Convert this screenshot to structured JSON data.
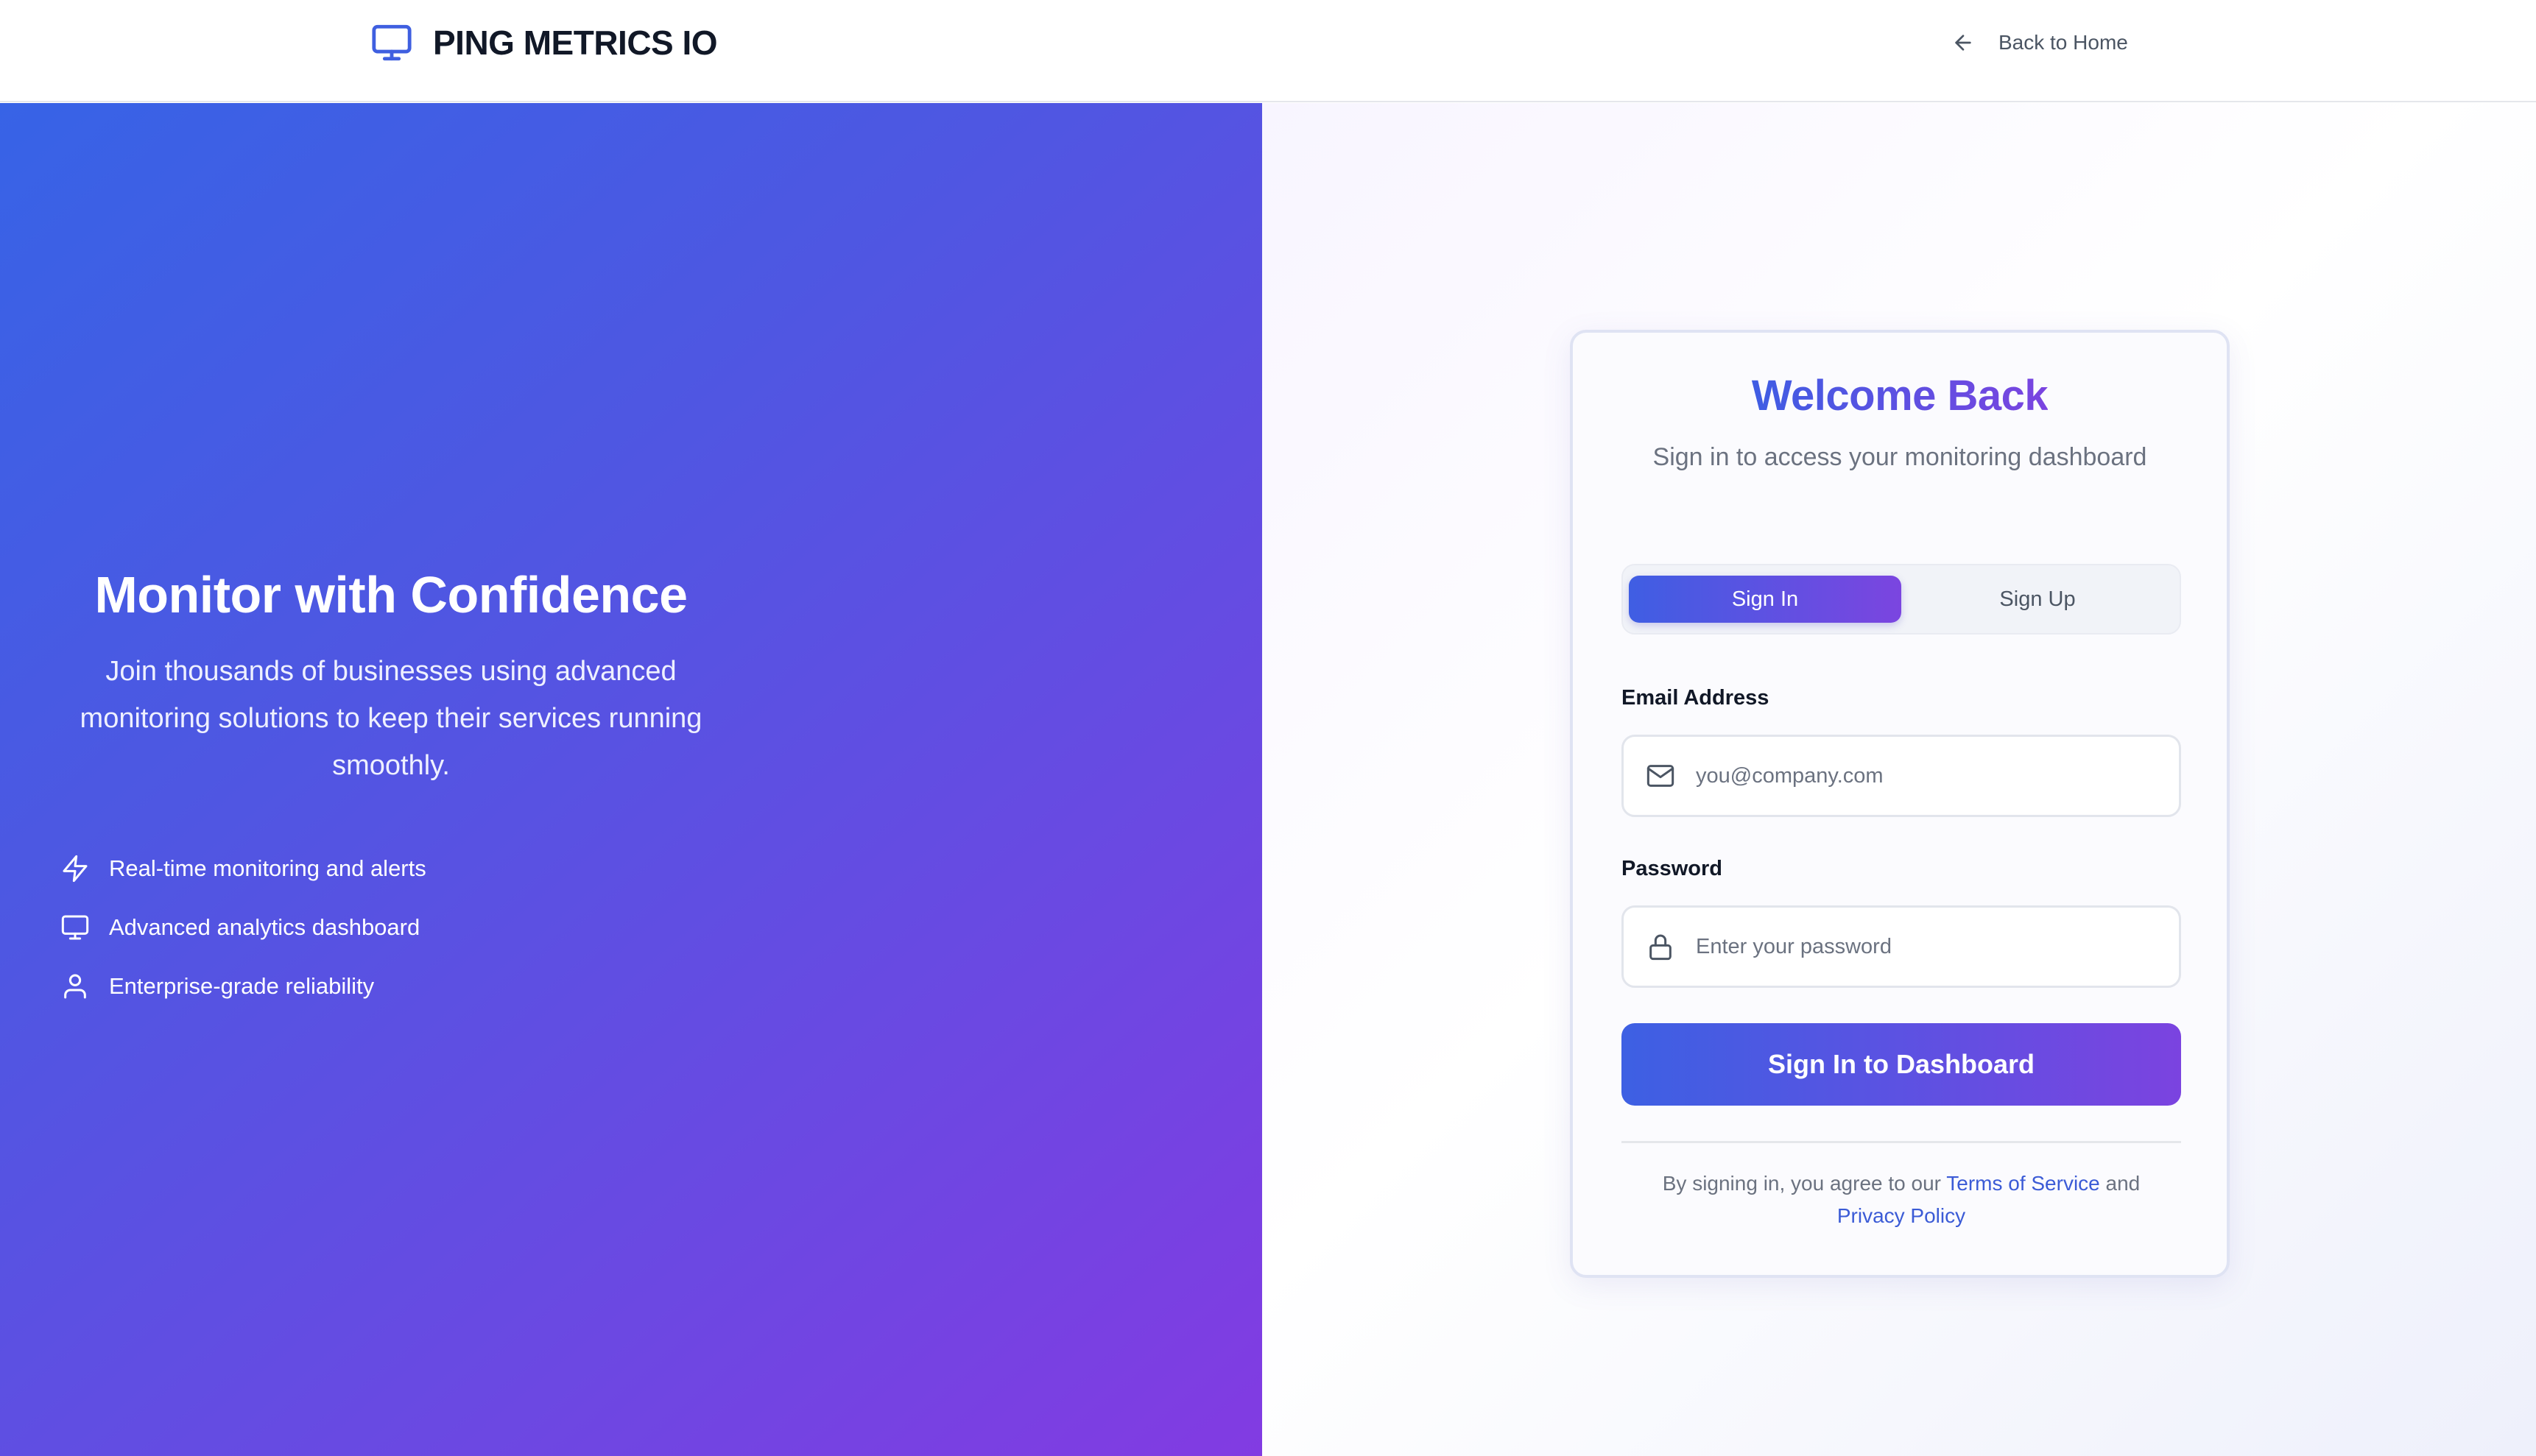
{
  "header": {
    "brand_name": "PING METRICS IO",
    "back_label": "Back to Home"
  },
  "hero": {
    "title": "Monitor with Confidence",
    "subtitle": "Join thousands of businesses using advanced monitoring solutions to keep their services running smoothly.",
    "features": [
      {
        "icon": "lightning-icon",
        "label": "Real-time monitoring and alerts"
      },
      {
        "icon": "monitor-icon",
        "label": "Advanced analytics dashboard"
      },
      {
        "icon": "user-icon",
        "label": "Enterprise-grade reliability"
      }
    ]
  },
  "login_card": {
    "title": "Welcome Back",
    "subtitle": "Sign in to access your monitoring dashboard",
    "tabs": [
      {
        "label": "Sign In",
        "active": true
      },
      {
        "label": "Sign Up",
        "active": false
      }
    ],
    "email": {
      "label": "Email Address",
      "placeholder": "you@company.com",
      "value": ""
    },
    "password": {
      "label": "Password",
      "placeholder": "Enter your password",
      "value": ""
    },
    "submit_label": "Sign In to Dashboard",
    "legal": {
      "prefix": "By signing in, you agree to our",
      "terms_link": "Terms of Service",
      "conjunction": "and",
      "privacy_link": "Privacy Policy"
    }
  },
  "colors": {
    "brand_blue": "#3763e6",
    "brand_purple": "#823be2",
    "link_blue": "#3b5bd6",
    "text_dark": "#111827",
    "text_muted": "#6b7280"
  }
}
